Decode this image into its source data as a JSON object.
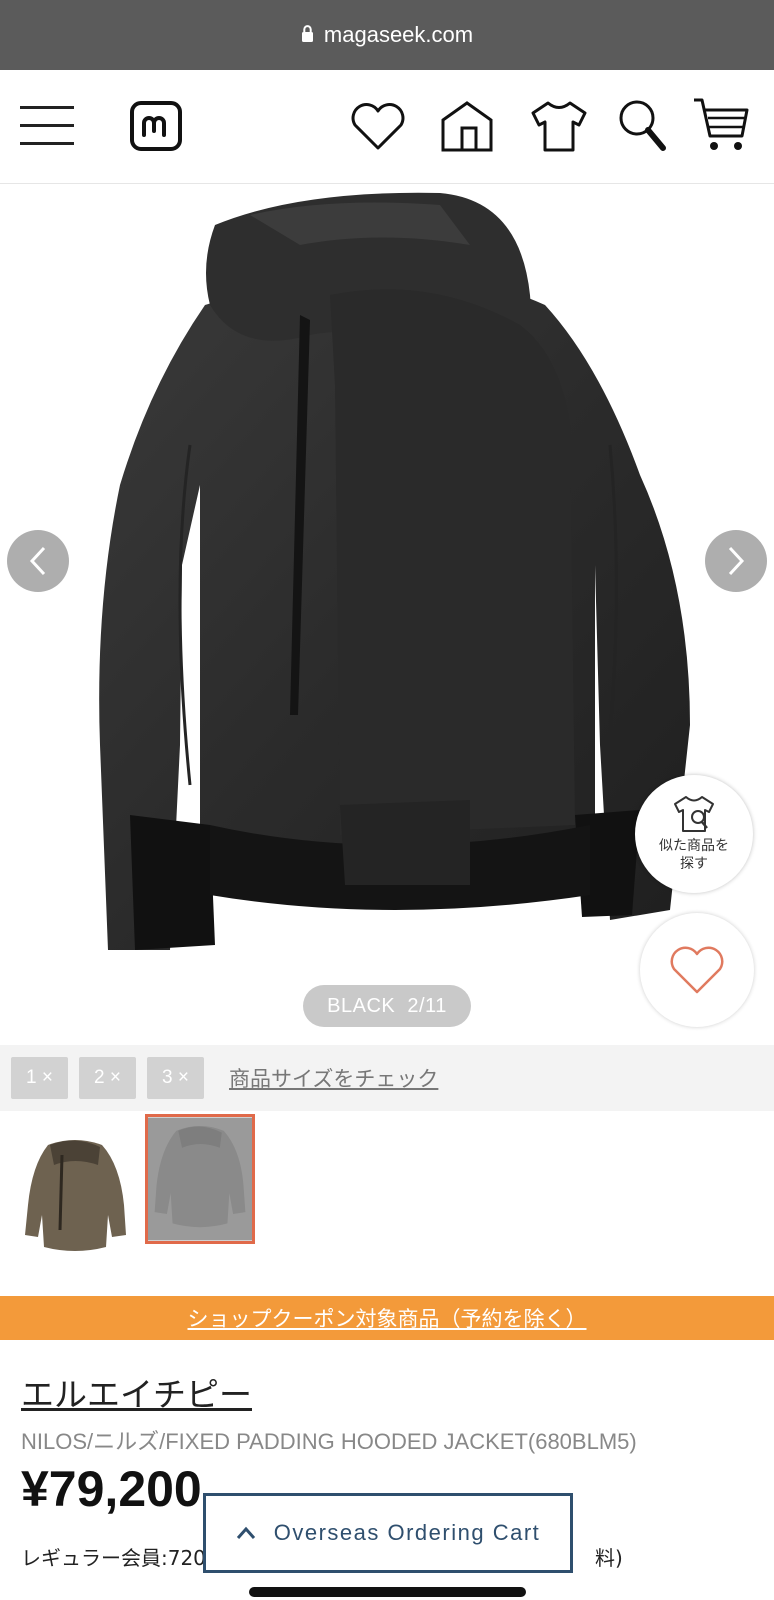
{
  "browser": {
    "url": "magaseek.com"
  },
  "header": {
    "icons": [
      "menu-icon",
      "magaseek-logo",
      "heart-icon",
      "shop-icon",
      "tshirt-icon",
      "search-icon",
      "cart-icon"
    ]
  },
  "gallery": {
    "color_label": "BLACK",
    "counter": "2/11",
    "similar_items_label": "似た商品を探す",
    "similar_line1": "似た商品を",
    "similar_line2": "探す"
  },
  "zoom": {
    "options": [
      "1 ×",
      "2 ×",
      "3 ×"
    ],
    "size_check_link": "商品サイズをチェック"
  },
  "thumbnails": [
    {
      "color": "brown",
      "selected": false
    },
    {
      "color": "black",
      "selected": true
    }
  ],
  "coupon_banner": "ショップクーポン対象商品（予約を除く）",
  "product": {
    "brand": "エルエイチピー",
    "name": "NILOS/ニルズ/FIXED PADDING HOODED JACKET(680BLM5)",
    "price": "¥79,200",
    "member_line_visible_start": "レギュラー会員:720",
    "member_line_visible_end": "料)"
  },
  "overseas_cart": {
    "label": "Overseas Ordering Cart"
  },
  "colors": {
    "accent_orange": "#f39a3a",
    "cart_blue": "#2f4f6e",
    "selected_border": "#e06a4a",
    "heart": "#e07a5f"
  }
}
